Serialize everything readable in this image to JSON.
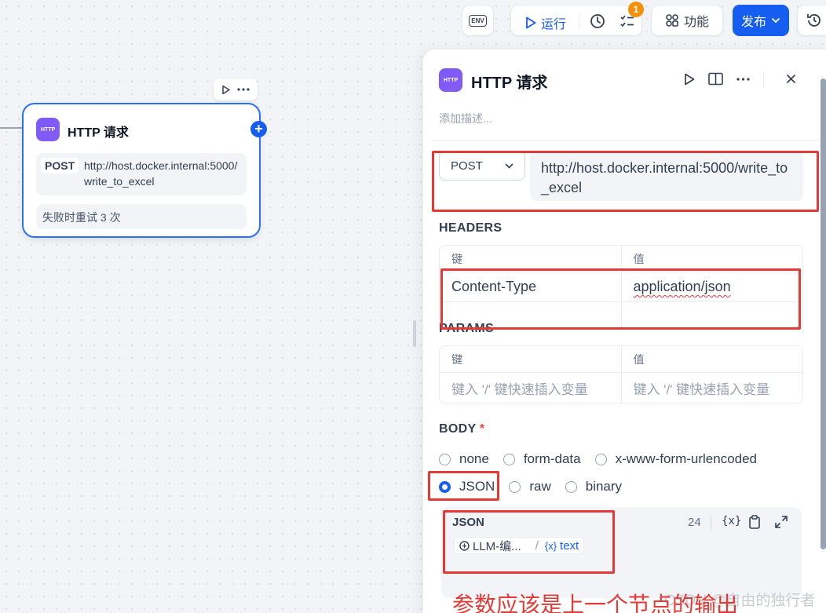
{
  "toolbar": {
    "env_label": "ENV",
    "run_label": "运行",
    "checklist_badge": "1",
    "features_label": "功能",
    "publish_label": "发布"
  },
  "node": {
    "icon_text": "HTTP",
    "title": "HTTP 请求",
    "method": "POST",
    "url": "http://host.docker.internal:5000/write_to_excel",
    "retry": "失败时重试 3 次"
  },
  "panel": {
    "icon_text": "HTTP",
    "title": "HTTP 请求",
    "description_placeholder": "添加描述...",
    "method": "POST",
    "url": "http://host.docker.internal:5000/write_to_excel",
    "headers": {
      "label": "HEADERS",
      "col_key": "键",
      "col_value": "值",
      "rows": [
        {
          "key": "Content-Type",
          "value": "application/json"
        }
      ]
    },
    "params": {
      "label": "PARAMS",
      "col_key": "键",
      "col_value": "值",
      "key_placeholder": "键入 '/' 键快速插入变量",
      "value_placeholder": "键入 '/' 键快速插入变量"
    },
    "body": {
      "label": "BODY",
      "required_mark": "*",
      "options": [
        "none",
        "form-data",
        "x-www-form-urlencoded",
        "JSON",
        "raw",
        "binary"
      ],
      "selected": "JSON",
      "editor_title": "JSON",
      "editor_count": "24",
      "variable_node": "LLM-编...",
      "variable_output": "text"
    }
  },
  "annotation": {
    "note": "参数应该是上一个节点的输出",
    "color": "#e53935"
  },
  "watermark": "CSDN @自由的独行者",
  "colors": {
    "accent": "#155eef",
    "node_icon": "#7a5af8",
    "badge": "#f79009"
  }
}
